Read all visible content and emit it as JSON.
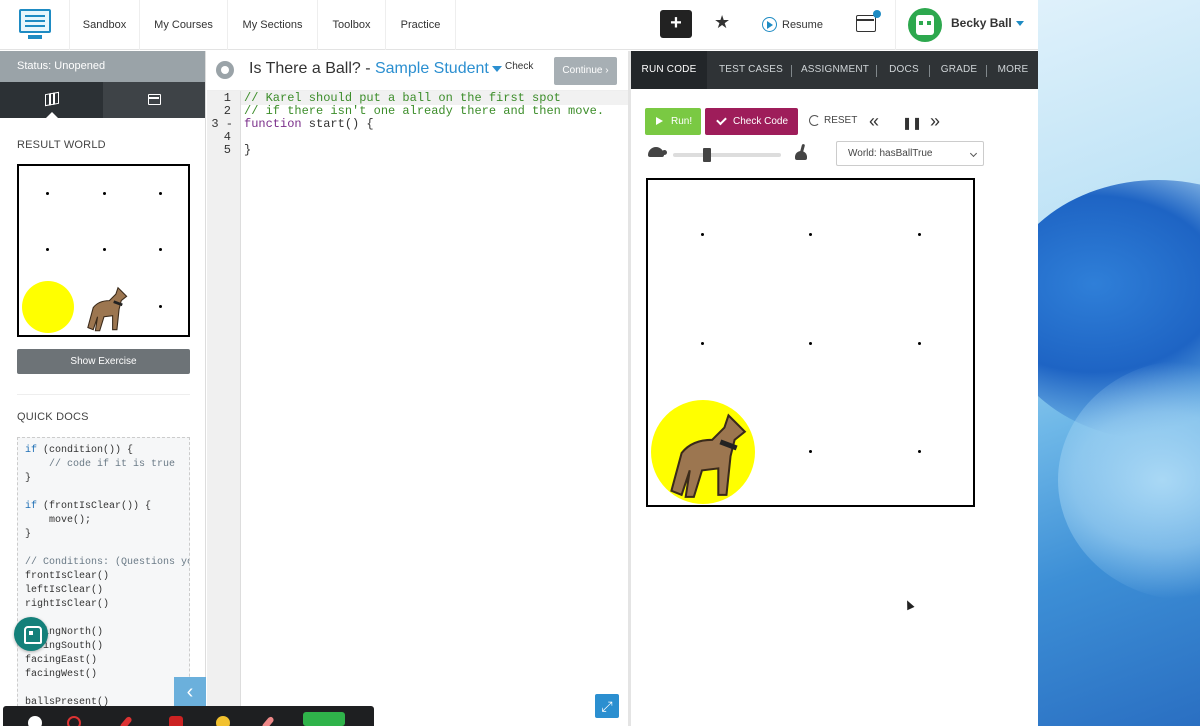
{
  "nav": {
    "items": [
      {
        "id": "sandbox",
        "label": "Sandbox"
      },
      {
        "id": "my-courses",
        "label": "My Courses"
      },
      {
        "id": "my-sections",
        "label": "My Sections"
      },
      {
        "id": "toolbox",
        "label": "Toolbox"
      },
      {
        "id": "practice",
        "label": "Practice"
      }
    ],
    "plus_label": "+",
    "resume_label": "Resume",
    "user_name": "Becky Ball"
  },
  "sidebar": {
    "status": "Status: Unopened",
    "result_world_label": "RESULT WORLD",
    "show_exercise_label": "Show Exercise",
    "quick_docs_label": "QUICK DOCS",
    "collapse_glyph": "‹"
  },
  "quick_docs": [
    {
      "kw": "if",
      "text": " (condition()) {"
    },
    {
      "cm": "    // code if it is true"
    },
    {
      "text": "}"
    },
    {
      "text": ""
    },
    {
      "kw": "if",
      "text": " (frontIsClear()) {"
    },
    {
      "text": "    move();"
    },
    {
      "text": "}"
    },
    {
      "text": ""
    },
    {
      "cm": "// Conditions: (Questions you"
    },
    {
      "text": "frontIsClear()"
    },
    {
      "text": "leftIsClear()"
    },
    {
      "text": "rightIsClear()"
    },
    {
      "text": ""
    },
    {
      "text": "facingNorth()"
    },
    {
      "text": "facingSouth()"
    },
    {
      "text": "facingEast()"
    },
    {
      "text": "facingWest()"
    },
    {
      "text": ""
    },
    {
      "text": "ballsPresent()"
    }
  ],
  "editor": {
    "title": "Is There a Ball? - ",
    "student": "Sample Student",
    "check_label": "Check",
    "continue_label": "Continue ›",
    "expand_glyph": "⤢",
    "lines": [
      {
        "num": "1",
        "text": "// Karel should put a ball on the first spot"
      },
      {
        "num": "2",
        "text": "// if there isn't one already there and then move."
      },
      {
        "num": "3 -",
        "kw": "function",
        "text": " start() {"
      },
      {
        "num": "4",
        "text": ""
      },
      {
        "num": "5",
        "text": "}"
      }
    ]
  },
  "right": {
    "tabs": [
      {
        "id": "run-code",
        "label": "RUN CODE"
      },
      {
        "id": "test-cases",
        "label": "TEST CASES"
      },
      {
        "id": "assignment",
        "label": "ASSIGNMENT"
      },
      {
        "id": "docs",
        "label": "DOCS"
      },
      {
        "id": "grade",
        "label": "GRADE"
      },
      {
        "id": "more",
        "label": "MORE"
      }
    ],
    "run_label": "Run!",
    "check_code_label": "Check Code",
    "reset_label": "RESET",
    "rewind_glyph": "«",
    "pause_glyph": "❚❚",
    "forward_glyph": "»",
    "world_select": "World: hasBallTrue",
    "speed": 0.3
  },
  "colors": {
    "accent": "#2b8fd0",
    "run": "#7ac943",
    "check_code": "#9e1d5a",
    "ball": "#ffff00",
    "dark_tabs": "#2f3336"
  }
}
